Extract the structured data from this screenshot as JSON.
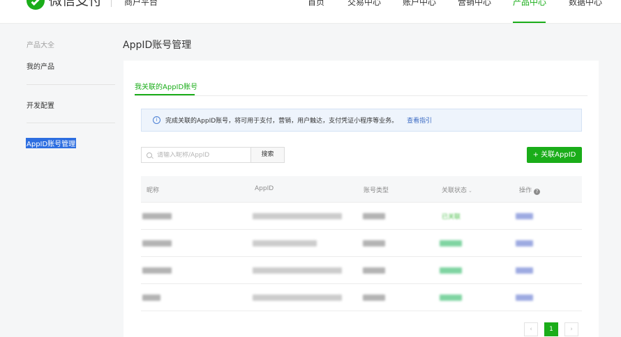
{
  "header": {
    "brand": "微信支付",
    "platform": "商户平台",
    "nav": [
      {
        "label": "首页",
        "active": false
      },
      {
        "label": "交易中心",
        "active": false
      },
      {
        "label": "账户中心",
        "active": false
      },
      {
        "label": "营销中心",
        "active": false
      },
      {
        "label": "产品中心",
        "active": true
      },
      {
        "label": "数据中心",
        "active": false
      }
    ]
  },
  "sidebar": {
    "group_title": "产品大全",
    "items": [
      {
        "label": "我的产品"
      },
      {
        "label": "开发配置"
      },
      {
        "label": "AppID账号管理",
        "active": true
      }
    ]
  },
  "page": {
    "title": "AppID账号管理",
    "tab": "我关联的AppID账号",
    "notice": {
      "icon": "info-icon",
      "text": "完成关联的AppID账号，将可用于支付，营销，用户触达，支付凭证小程序等业务。",
      "link": "查看指引"
    },
    "search": {
      "placeholder": "请输入昵称/AppID",
      "button": "搜索"
    },
    "add_button": "+ 关联AppID",
    "table": {
      "columns": [
        "昵称",
        "AppID",
        "账号类型",
        "关联状态",
        "操作"
      ],
      "sort_caret": "⌄",
      "help_icon": "?",
      "rows": [
        {
          "status_text": "已关联"
        },
        {
          "status_text": ""
        },
        {
          "status_text": ""
        },
        {
          "status_text": ""
        }
      ]
    },
    "pagination": {
      "prev": "‹",
      "current": "1",
      "next": "›"
    }
  },
  "colors": {
    "brand_green": "#1aad19",
    "link_blue": "#3d6cc4",
    "selection_blue": "#2d6ee0"
  }
}
